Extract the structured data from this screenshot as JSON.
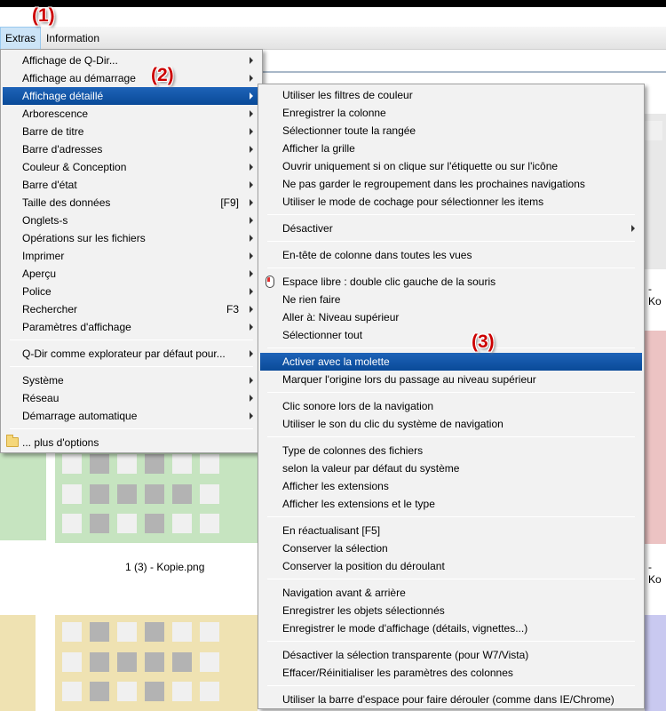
{
  "annotations": [
    "(1)",
    "(2)",
    "(3)"
  ],
  "menubar": {
    "extras": "Extras",
    "information": "Information"
  },
  "menu1": {
    "items": [
      {
        "label": "Affichage de Q-Dir...",
        "sub": true
      },
      {
        "label": "Affichage au démarrage",
        "sub": true
      },
      {
        "label": "Affichage détaillé",
        "sub": true
      },
      {
        "label": "Arborescence",
        "sub": true
      },
      {
        "label": "Barre de titre",
        "sub": true
      },
      {
        "label": "Barre d'adresses",
        "sub": true
      },
      {
        "label": "Couleur & Conception",
        "sub": true
      },
      {
        "label": "Barre d'état",
        "sub": true
      },
      {
        "label": "Taille des données",
        "shortcut": "[F9]",
        "sub": true
      },
      {
        "label": "Onglets-s",
        "sub": true
      },
      {
        "label": "Opérations sur les fichiers",
        "sub": true
      },
      {
        "label": "Imprimer",
        "sub": true
      },
      {
        "label": "Aperçu",
        "sub": true
      },
      {
        "label": "Police",
        "sub": true
      },
      {
        "label": "Rechercher",
        "shortcut": "F3",
        "sub": true
      },
      {
        "label": "Paramètres d'affichage",
        "sub": true
      },
      {
        "label": "Q-Dir comme explorateur par défaut pour...",
        "sub": true
      },
      {
        "label": "Système",
        "sub": true
      },
      {
        "label": "Réseau",
        "sub": true
      },
      {
        "label": "Démarrage automatique",
        "sub": true
      },
      {
        "label": "... plus d'options",
        "sub": false
      }
    ]
  },
  "menu2": {
    "items": [
      "Utiliser les filtres de couleur",
      "Enregistrer la colonne",
      "Sélectionner toute la rangée",
      "Afficher la grille",
      "Ouvrir uniquement si on clique sur l'étiquette ou sur l'icône",
      "Ne pas garder le regroupement dans les prochaines navigations",
      "Utiliser le mode de cochage pour sélectionner les items",
      "Désactiver",
      "En-tête de colonne dans toutes les vues",
      "Espace libre : double clic gauche de la souris",
      "Ne rien faire",
      "Aller à: Niveau supérieur",
      "Sélectionner tout",
      "Activer avec la molette",
      "Marquer l'origine lors du passage au niveau supérieur",
      "Clic sonore lors de la navigation",
      "Utiliser le son du clic du système de navigation",
      "Type de colonnes des fichiers",
      "selon la valeur par défaut du système",
      "Afficher les extensions",
      "Afficher les extensions et le type",
      "En réactualisant [F5]",
      "Conserver la sélection",
      "Conserver la position du déroulant",
      "Navigation avant & arrière",
      "Enregistrer les objets sélectionnés",
      "Enregistrer le mode d'affichage (détails, vignettes...)",
      "Désactiver la sélection transparente (pour W7/Vista)",
      "Effacer/Réinitialiser les paramètres des colonnes",
      "Utiliser la barre d'espace pour faire dérouler (comme dans IE/Chrome)"
    ]
  },
  "background": {
    "file_label": "1 (3) - Kopie.png",
    "side_label_1": "- Ko",
    "side_label_2": "- Ko"
  },
  "colors": {
    "highlight": "#0a4a98",
    "annotation": "#cc0000"
  }
}
